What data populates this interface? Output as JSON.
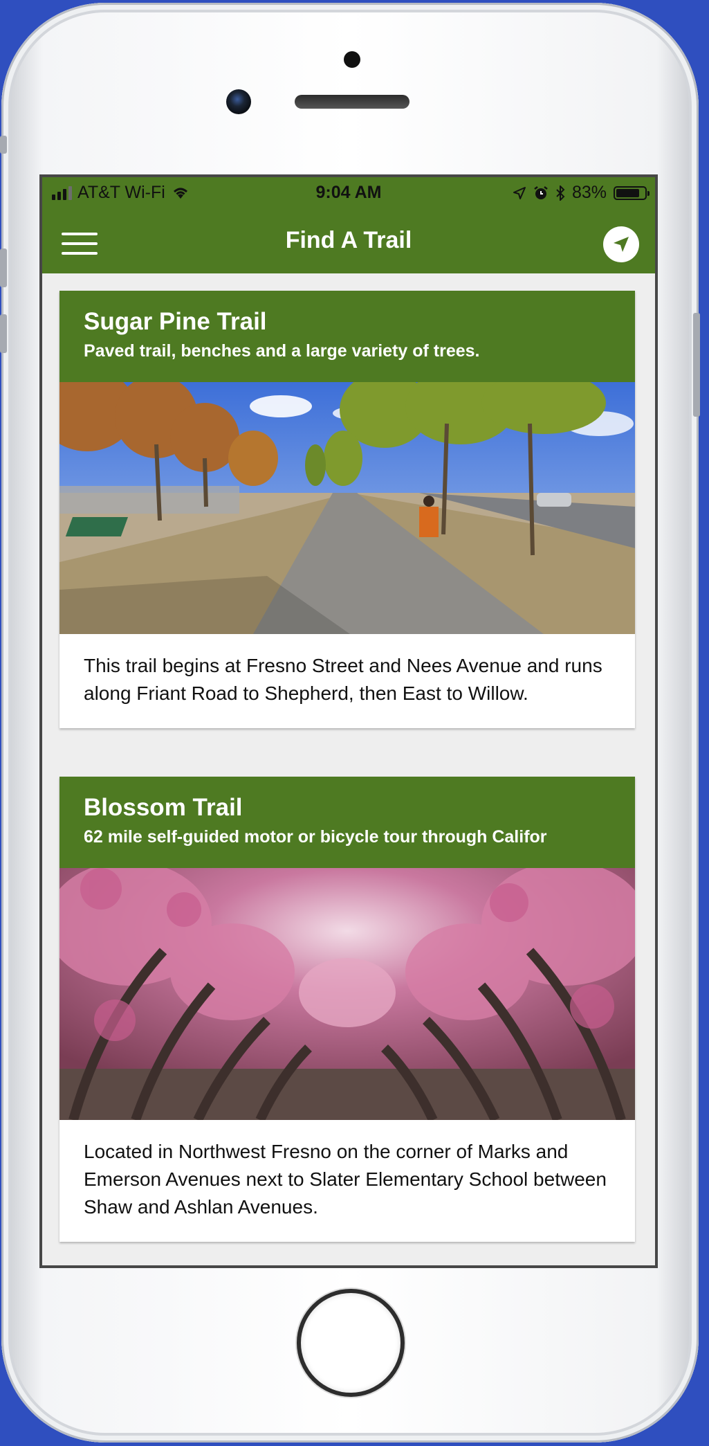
{
  "status_bar": {
    "carrier": "AT&T Wi-Fi",
    "time": "9:04 AM",
    "battery": "83%",
    "battery_level": 0.83
  },
  "app_bar": {
    "title": "Find A Trail",
    "menu_icon": "hamburger-menu-icon",
    "locate_icon": "location-arrow-icon"
  },
  "colors": {
    "primary": "#4e7a22",
    "background": "#eeeeee",
    "device_background": "#2f4fbf"
  },
  "trails": [
    {
      "name": "Sugar Pine Trail",
      "subtitle": "Paved trail, benches and a large variety of trees.",
      "description": "This trail begins at Fresno Street and Nees Avenue and runs along Friant Road to Shepherd, then East to Willow."
    },
    {
      "name": "Blossom Trail",
      "subtitle": "62 mile self-guided motor or bicycle tour through Califor",
      "description": "Located in Northwest Fresno on the corner of Marks and Emerson Avenues next to Slater Elementary School between Shaw and Ashlan Avenues."
    }
  ]
}
